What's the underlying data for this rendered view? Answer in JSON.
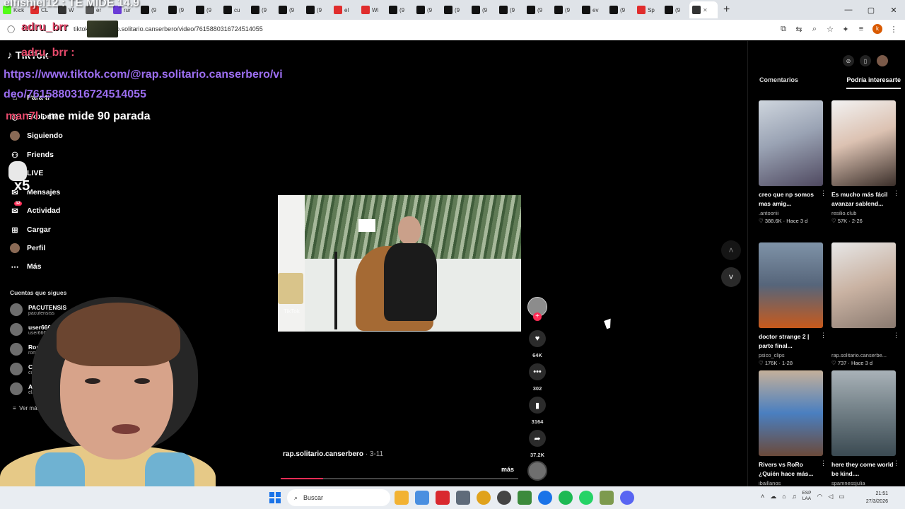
{
  "browser": {
    "active_tab_label": "",
    "address_url": "tiktok.com/@rap.solitario.canserbero/video/7615880316724514055",
    "tab_labels": [
      "Kick",
      "CL",
      "W",
      "er",
      "rur",
      "(9",
      "(9",
      "(9",
      "cu",
      "(9",
      "(9",
      "(9",
      "el",
      "Wi",
      "(9",
      "(9",
      "(9",
      "(9",
      "(9",
      "(9",
      "(9",
      "ev",
      "(9",
      "Sp",
      "(9"
    ]
  },
  "stream_overlay": {
    "top_text": "elfishjel12 : TE MIDE 14.9",
    "name_overlay": "adru_brr",
    "chat_user": "adru_brr :",
    "chat_link": "https://www.tiktok.com/@rap.solitario.canserbero/video/7615880316724514055",
    "chat_user2": "man7l",
    "chat_msg2": ": me mide 90 parada",
    "emote_text": "x5"
  },
  "sidebar": {
    "logo": "TikTok",
    "items": [
      {
        "label": "Para ti",
        "icon": "home-icon"
      },
      {
        "label": "Explorar",
        "icon": "compass-icon"
      },
      {
        "label": "Siguiendo",
        "icon": "following-icon"
      },
      {
        "label": "Friends",
        "icon": "friends-icon"
      },
      {
        "label": "LIVE",
        "icon": "live-icon"
      },
      {
        "label": "Mensajes",
        "icon": "messages-icon"
      },
      {
        "label": "Actividad",
        "icon": "activity-icon",
        "badge": "32"
      },
      {
        "label": "Cargar",
        "icon": "upload-icon"
      },
      {
        "label": "Perfil",
        "icon": "profile-icon"
      },
      {
        "label": "Más",
        "icon": "more-icon"
      }
    ],
    "follows_title": "Cuentas que sigues",
    "accounts": [
      {
        "name": "PACUTENSIS",
        "handle": "pacutensiss"
      },
      {
        "name": "user6666 699",
        "handle": "user6666 699"
      },
      {
        "name": "Romanla",
        "handle": "romanlauta"
      },
      {
        "name": "Cufasito",
        "handle": "cufaszclips_"
      },
      {
        "name": "Alfon",
        "handle": "elalfonn_"
      }
    ],
    "see_more": "Ver más"
  },
  "video": {
    "watermark": "TikTok",
    "author": "rap.solitario.canserbero",
    "date": "3-11",
    "more_label": "más",
    "progress": 0.18,
    "likes": "64K",
    "comments": "302",
    "saves": "3164",
    "shares": "37.2K"
  },
  "right_panel": {
    "tabs": [
      "Comentarios",
      "Podría interesarte"
    ],
    "active_tab": 1,
    "cards": [
      {
        "title": "creo que np somos mas amig...",
        "author": ".antooriii",
        "stats": "388.6K · Hace 3 d"
      },
      {
        "title": "Es mucho más fácil avanzar sablend...",
        "author": "resilio.club",
        "stats": "57K · 2-26"
      },
      {
        "title": "doctor strange 2 | parte final...",
        "author": "psico_clips",
        "stats": "176K · 1-28"
      },
      {
        "title": "",
        "author": "rap.solitario.canserbe...",
        "stats": "737 · Hace 3 d"
      },
      {
        "title": "Rivers vs RoRo ¿Quién hace más...",
        "author": "ibaillanos",
        "stats": ""
      },
      {
        "title": "here they come world be kind....",
        "author": "spamnessjulia",
        "stats": ""
      }
    ]
  },
  "taskbar": {
    "search_placeholder": "Buscar",
    "lang": "ESP",
    "lang2": "LAA",
    "time": "21:51",
    "date": "27/3/2026"
  },
  "colors": {
    "accent": "#fe2c55",
    "chat_name": "#e94a6c",
    "chat_link": "#9c6ef0"
  }
}
